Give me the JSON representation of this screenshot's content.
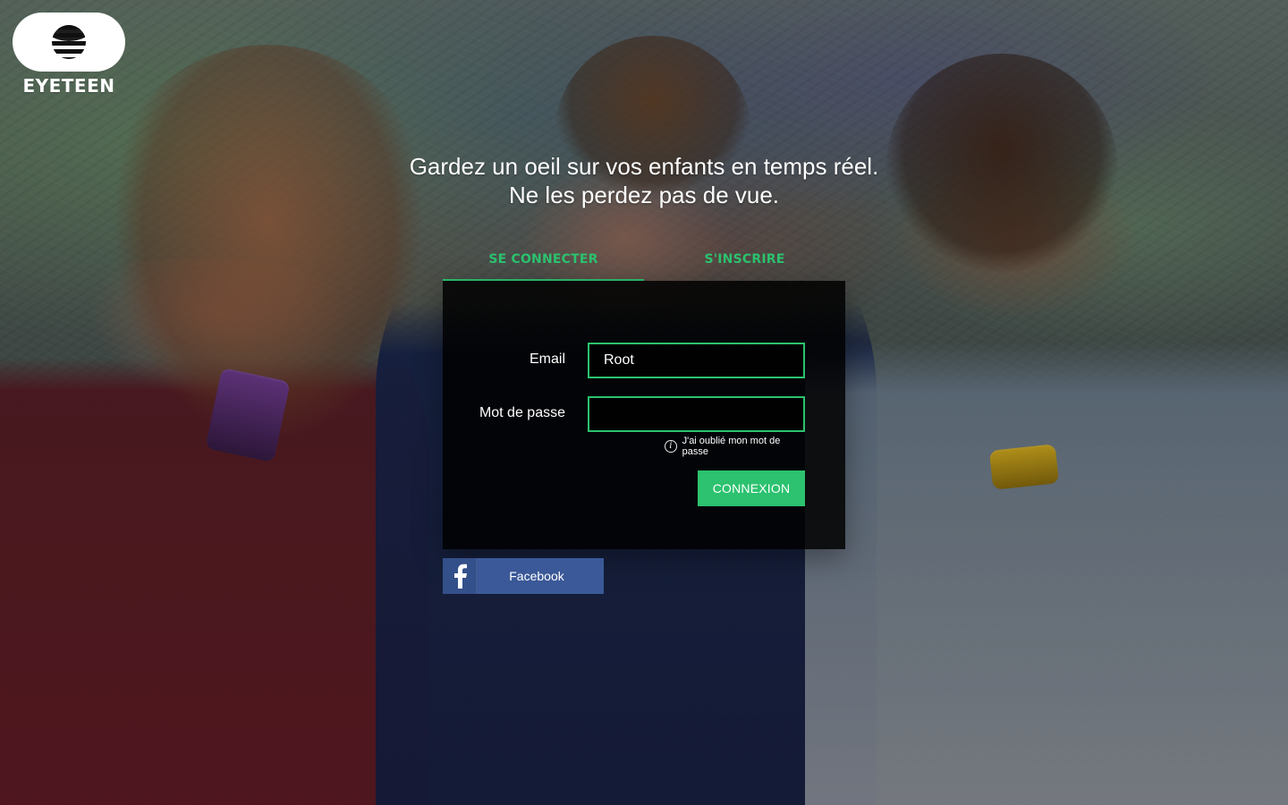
{
  "brand": {
    "name": "EYETEEN",
    "accent": "#2cc26f",
    "facebook_blue": "#3b5998"
  },
  "hero": {
    "line1": "Gardez un oeil sur vos enfants en temps réel.",
    "line2": "Ne les perdez pas de vue."
  },
  "tabs": {
    "login_label": "SE CONNECTER",
    "signup_label": "S'INSCRIRE"
  },
  "login": {
    "email_label": "Email",
    "email_value": "Root",
    "password_label": "Mot de passe",
    "password_value": "",
    "forgot_label": "J'ai oublié mon mot de passe",
    "submit_label": "CONNEXION"
  },
  "social": {
    "facebook_label": "Facebook"
  },
  "icons": {
    "logo": "eye-logo-icon",
    "info": "info-icon",
    "facebook": "facebook-icon"
  }
}
